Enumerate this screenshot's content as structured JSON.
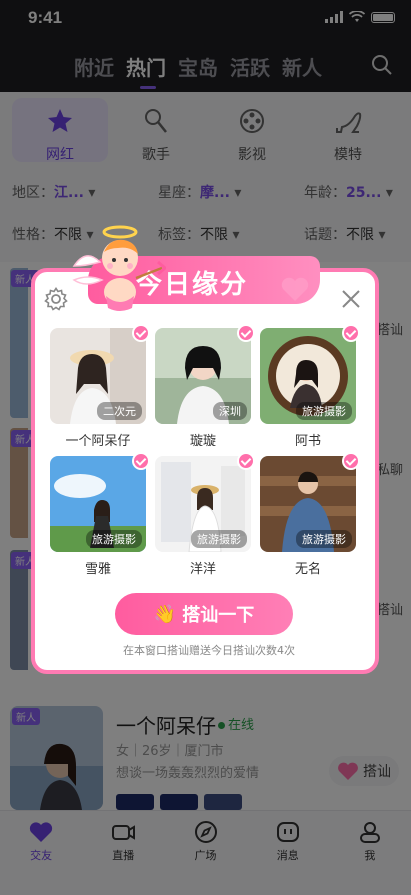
{
  "status_bar": {
    "time": "9:41"
  },
  "top_tabs": [
    "附近",
    "热门",
    "宝岛",
    "活跃",
    "新人"
  ],
  "categories": [
    "网红",
    "歌手",
    "影视",
    "模特"
  ],
  "filters": {
    "row1": [
      {
        "label": "地区：",
        "value": "江..."
      },
      {
        "label": "星座：",
        "value": "摩..."
      },
      {
        "label": "年龄：",
        "value": "25..."
      }
    ],
    "row2": [
      {
        "label": "性格：",
        "value": "不限"
      },
      {
        "label": "标签：",
        "value": "不限"
      },
      {
        "label": "话题：",
        "value": "不限"
      }
    ]
  },
  "side_labels": {
    "new": "新人",
    "flirt": "搭讪",
    "chat": "私聊"
  },
  "modal": {
    "title": "今日缘分",
    "people": [
      {
        "name": "一个阿呆仔",
        "tag": "二次元"
      },
      {
        "name": "璇璇",
        "tag": "深圳"
      },
      {
        "name": "阿书",
        "tag": "旅游摄影"
      },
      {
        "name": "雪雅",
        "tag": "旅游摄影"
      },
      {
        "name": "洋洋",
        "tag": "旅游摄影"
      },
      {
        "name": "无名",
        "tag": "旅游摄影"
      }
    ],
    "cta_emoji": "👋",
    "cta_label": "搭讪一下",
    "hint": "在本窗口搭讪赠送今日搭讪次数4次"
  },
  "profile": {
    "badge": "新人",
    "name": "一个阿呆仔",
    "status": "在线",
    "meta": "女｜26岁｜厦门市",
    "bio": "想谈一场轰轰烈烈的爱情",
    "action": "搭讪"
  },
  "bottom_nav": [
    "交友",
    "直播",
    "广场",
    "消息",
    "我"
  ],
  "colors": {
    "accent": "#8a63f6",
    "pink": "#ff6fab"
  }
}
